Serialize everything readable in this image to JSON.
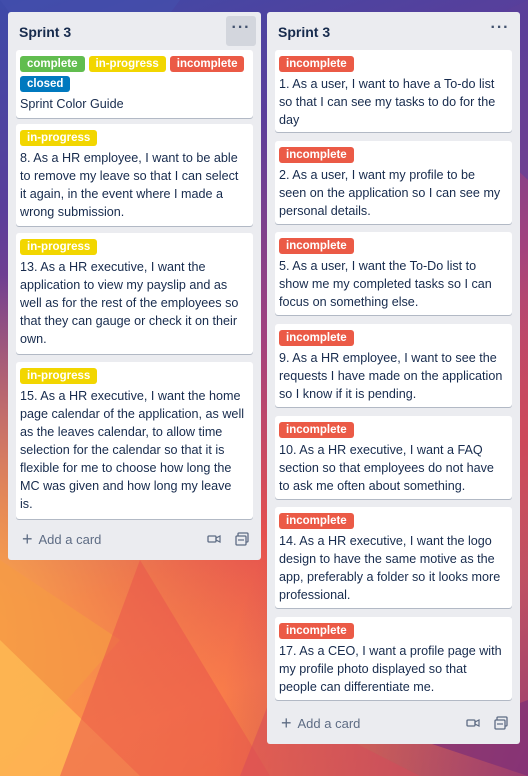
{
  "lists": [
    {
      "title": "Sprint 3",
      "menu_icon": "ellipsis-icon",
      "cards": [
        {
          "labels": [
            {
              "text": "complete",
              "kind": "complete"
            },
            {
              "text": "in-progress",
              "kind": "in-progress"
            },
            {
              "text": "incomplete",
              "kind": "incomplete"
            },
            {
              "text": "closed",
              "kind": "closed"
            }
          ],
          "title": "Sprint Color Guide"
        },
        {
          "labels": [
            {
              "text": "in-progress",
              "kind": "in-progress"
            }
          ],
          "title": "8. As a HR employee, I want to be able to remove my leave so that I can select it again, in the event where I made a wrong submission."
        },
        {
          "labels": [
            {
              "text": "in-progress",
              "kind": "in-progress"
            }
          ],
          "title": "13. As a HR executive, I want the application to view my payslip and as well as for the rest of the employees so that they can gauge or check it on their own."
        },
        {
          "labels": [
            {
              "text": "in-progress",
              "kind": "in-progress"
            }
          ],
          "title": "15. As a HR executive, I want the home page calendar of the application, as well as the leaves calendar, to allow time selection for the calendar so that it is flexible for me to choose how long the MC was given and how long my leave is."
        }
      ],
      "add_card_label": "Add a card"
    },
    {
      "title": "Sprint 3",
      "menu_icon": "ellipsis-icon",
      "cards": [
        {
          "labels": [
            {
              "text": "incomplete",
              "kind": "incomplete"
            }
          ],
          "title": "1. As a user, I want to have a To-do list so that I can see my tasks to do for the day"
        },
        {
          "labels": [
            {
              "text": "incomplete",
              "kind": "incomplete"
            }
          ],
          "title": "2. As a user, I want my profile to be seen on the application so I can see my personal details."
        },
        {
          "labels": [
            {
              "text": "incomplete",
              "kind": "incomplete"
            }
          ],
          "title": "5. As a user, I want the To-Do list to show me my completed tasks so I can focus on something else."
        },
        {
          "labels": [
            {
              "text": "incomplete",
              "kind": "incomplete"
            }
          ],
          "title": "9. As a HR employee, I want to see the requests I have made on the application so I know if it is pending."
        },
        {
          "labels": [
            {
              "text": "incomplete",
              "kind": "incomplete"
            }
          ],
          "title": "10. As a HR executive, I want a FAQ section so that employees do not have to ask me often about something."
        },
        {
          "labels": [
            {
              "text": "incomplete",
              "kind": "incomplete"
            }
          ],
          "title": "14. As a HR executive, I want the logo design to have the same motive as the app, preferably a folder so it looks more professional."
        },
        {
          "labels": [
            {
              "text": "incomplete",
              "kind": "incomplete"
            }
          ],
          "title": "17. As a CEO, I want a profile page with my profile photo displayed so that people can differentiate me."
        }
      ],
      "add_card_label": "Add a card"
    }
  ],
  "colors": {
    "complete": "#61bd4f",
    "in_progress": "#f2d600",
    "incomplete": "#eb5a46",
    "closed": "#0079bf",
    "list_bg": "#ebecf0"
  }
}
